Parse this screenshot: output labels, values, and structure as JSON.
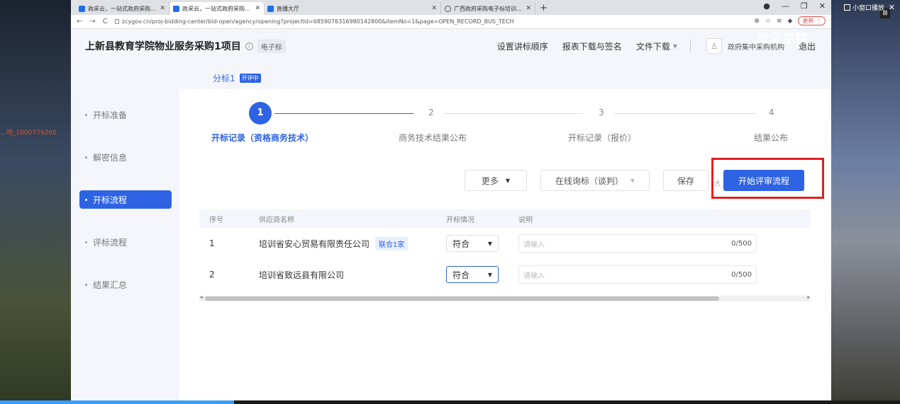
{
  "desktop": {
    "left_text": "…吧_1000779260",
    "mini_window_label": "小窗口播放"
  },
  "browser": {
    "tabs": [
      {
        "title": "政采云，一站式政府采购云平台",
        "active": false
      },
      {
        "title": "政采云，一站式政府采购云平台",
        "active": true
      },
      {
        "title": "直播大厅",
        "active": false
      },
      {
        "title": "广西政府采购电子标培训评审专",
        "active": false
      }
    ],
    "url": "zcygov.cn/proj-bidding-center/bid-open/agency/opening?projectId=6859076316980142800&itemNo=1&page=OPEN_RECORD_BUS_TECH",
    "update_label": "更新"
  },
  "watermark": "政采学院",
  "header": {
    "title": "上新县教育学院物业服务采购1项目",
    "tag": "电子标",
    "nav": [
      "设置讲标顺序",
      "报表下载与签名",
      "文件下载"
    ],
    "org": "政府集中采购机构",
    "logout": "退出"
  },
  "subtab": {
    "label": "分标1",
    "badge": "开评中"
  },
  "sidebar": {
    "items": [
      {
        "label": "开标准备",
        "active": false
      },
      {
        "label": "解密信息",
        "active": false
      },
      {
        "label": "开标流程",
        "active": true
      },
      {
        "label": "评标流程",
        "active": false
      },
      {
        "label": "结果汇总",
        "active": false
      }
    ]
  },
  "steps": [
    {
      "num": "1",
      "label": "开标记录（资格商务技术）",
      "active": true
    },
    {
      "num": "2",
      "label": "商务技术结果公布",
      "active": false
    },
    {
      "num": "3",
      "label": "开标记录（报价）",
      "active": false
    },
    {
      "num": "4",
      "label": "结果公布",
      "active": false
    }
  ],
  "actions": {
    "more": "更多",
    "inquiry": "在线询标（谈判）",
    "save": "保存",
    "start": "开始评审流程"
  },
  "table": {
    "headers": [
      "序号",
      "供应商名称",
      "开标情况",
      "说明"
    ],
    "rows": [
      {
        "no": "1",
        "name": "培训省安心贸易有限责任公司",
        "tag": "联合1家",
        "status": "符合",
        "placeholder": "请输入",
        "count": "0/500"
      },
      {
        "no": "2",
        "name": "培训省致远县有限公司",
        "tag": "",
        "status": "符合",
        "placeholder": "请输入",
        "count": "0/500"
      }
    ]
  },
  "colors": {
    "primary": "#2e63e3",
    "highlight": "#e02020"
  }
}
